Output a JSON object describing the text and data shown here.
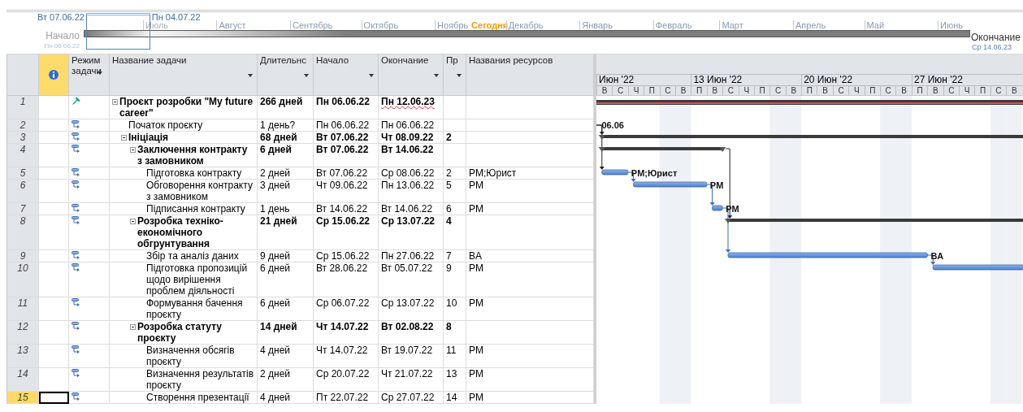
{
  "timeline": {
    "range_start": "Вт 07.06.22",
    "range_end": "Пн 04.07.22",
    "start_label": "Начало",
    "start_date": "Пн 06.06.22",
    "end_label": "Окончание",
    "end_date": "Ср 14.06.23",
    "months": [
      {
        "label": "Июль",
        "dimmed": true
      },
      {
        "label": "Август",
        "dimmed": false
      },
      {
        "label": "Сентябрь",
        "dimmed": false
      },
      {
        "label": "Октябрь",
        "dimmed": false
      },
      {
        "label": "Ноябрь",
        "dimmed": false,
        "today": "Сегодня"
      },
      {
        "label": "Декабрь",
        "dimmed": false
      },
      {
        "label": "Январь",
        "dimmed": false
      },
      {
        "label": "Февраль",
        "dimmed": false
      },
      {
        "label": "Март",
        "dimmed": false
      },
      {
        "label": "Апрель",
        "dimmed": false
      },
      {
        "label": "Май",
        "dimmed": false
      },
      {
        "label": "Июнь",
        "dimmed": false
      }
    ]
  },
  "table": {
    "columns": [
      {
        "label": "Режим задачи",
        "filter": true
      },
      {
        "label": "Название задачи",
        "filter": true
      },
      {
        "label": "Длительнс",
        "filter": true
      },
      {
        "label": "Начало",
        "filter": true
      },
      {
        "label": "Окончание",
        "filter": true
      },
      {
        "label": "Пр",
        "filter": true
      },
      {
        "label": "Названия ресурсов",
        "filter": false
      }
    ],
    "rows": [
      {
        "id": "1",
        "manual": true,
        "kind": "project",
        "name": "Проєкт розробки \"My future career\"",
        "duration": "266 дней",
        "start": "Пн 06.06.22",
        "finish": "Пн 12.06.23",
        "finish_flagged": true,
        "expanded": true,
        "selected": false,
        "children": [
          {
            "id": "2",
            "manual": false,
            "kind": "milestone",
            "name": "Початок проєкту",
            "duration": "1 день?",
            "start": "Пн 06.06.22",
            "finish": "Пн 06.06.22",
            "selected": false,
            "bar_label": "06.06"
          },
          {
            "id": "3",
            "manual": false,
            "kind": "summary",
            "name": "Ініціація",
            "duration": "68 дней",
            "start": "Вт 07.06.22",
            "finish": "Чт 08.09.22",
            "predecessors": "2",
            "expanded": true,
            "selected": false,
            "children": [
              {
                "id": "4",
                "manual": false,
                "kind": "summary",
                "name": "Заключення контракту з замовником",
                "duration": "6 дней",
                "start": "Вт 07.06.22",
                "finish": "Вт 14.06.22",
                "expanded": true,
                "selected": false,
                "children": [
                  {
                    "id": "5",
                    "manual": false,
                    "kind": "task",
                    "name": "Підготовка контракту",
                    "duration": "2 дней",
                    "start": "Вт 07.06.22",
                    "finish": "Ср 08.06.22",
                    "predecessors": "2",
                    "resources": "PM;Юрист",
                    "selected": false,
                    "bar_label": "PM;Юрист"
                  },
                  {
                    "id": "6",
                    "manual": false,
                    "kind": "task",
                    "name": "Обговорення контракту з замовником",
                    "duration": "3 дней",
                    "start": "Чт 09.06.22",
                    "finish": "Пн 13.06.22",
                    "predecessors": "5",
                    "resources": "PM",
                    "selected": false,
                    "bar_label": "PM"
                  },
                  {
                    "id": "7",
                    "manual": false,
                    "kind": "task",
                    "name": "Підписання контракту",
                    "duration": "1 день",
                    "start": "Вт 14.06.22",
                    "finish": "Вт 14.06.22",
                    "predecessors": "6",
                    "resources": "PM",
                    "selected": false,
                    "bar_label": "PM"
                  }
                ]
              },
              {
                "id": "8",
                "manual": false,
                "kind": "summary",
                "name": "Розробка техніко-економічного обгрунтування",
                "duration": "21 дней",
                "start": "Ср 15.06.22",
                "finish": "Ср 13.07.22",
                "predecessors": "4",
                "expanded": true,
                "selected": false,
                "children": [
                  {
                    "id": "9",
                    "manual": false,
                    "kind": "task",
                    "name": "Збір та аналіз даних",
                    "duration": "9 дней",
                    "start": "Ср 15.06.22",
                    "finish": "Пн 27.06.22",
                    "predecessors": "7",
                    "resources": "BA",
                    "selected": false,
                    "bar_label": "BA"
                  },
                  {
                    "id": "10",
                    "manual": false,
                    "kind": "task",
                    "name": "Підготовка пропозицій щодо вирішення проблем діяльності",
                    "duration": "6 дней",
                    "start": "Вт 28.06.22",
                    "finish": "Вт 05.07.22",
                    "predecessors": "9",
                    "resources": "PM",
                    "selected": false
                  },
                  {
                    "id": "11",
                    "manual": false,
                    "kind": "task",
                    "name": "Формування бачення проєкту",
                    "duration": "6 дней",
                    "start": "Ср 06.07.22",
                    "finish": "Ср 13.07.22",
                    "predecessors": "10",
                    "resources": "PM",
                    "selected": false
                  }
                ]
              },
              {
                "id": "12",
                "manual": false,
                "kind": "summary",
                "name": "Розробка статуту проєкту",
                "duration": "14 дней",
                "start": "Чт 14.07.22",
                "finish": "Вт 02.08.22",
                "predecessors": "8",
                "expanded": true,
                "selected": false,
                "children": [
                  {
                    "id": "13",
                    "manual": false,
                    "kind": "task",
                    "name": "Визначення обсягів проєкту",
                    "duration": "4 дней",
                    "start": "Чт 14.07.22",
                    "finish": "Вт 19.07.22",
                    "predecessors": "11",
                    "resources": "PM",
                    "selected": false
                  },
                  {
                    "id": "14",
                    "manual": false,
                    "kind": "task",
                    "name": "Визначення результатів проєкту",
                    "duration": "2 дней",
                    "start": "Ср 20.07.22",
                    "finish": "Чт 21.07.22",
                    "predecessors": "13",
                    "resources": "PM",
                    "selected": false
                  },
                  {
                    "id": "15",
                    "manual": false,
                    "kind": "task",
                    "name": "Створення презентації",
                    "duration": "4 дней",
                    "start": "Пт 22.07.22",
                    "finish": "Ср 27.07.22",
                    "predecessors": "14",
                    "resources": "PM",
                    "selected": true
                  }
                ]
              }
            ]
          }
        ]
      }
    ]
  },
  "gantt": {
    "weeks": [
      {
        "label": "Июн '22",
        "days": [
          "В",
          "С",
          "Ч",
          "П",
          "С",
          "В"
        ]
      },
      {
        "label": "13 Июн '22",
        "days": [
          "П",
          "В",
          "С",
          "Ч",
          "П",
          "С",
          "В"
        ]
      },
      {
        "label": "20 Июн '22",
        "days": [
          "П",
          "В",
          "С",
          "Ч",
          "П",
          "С",
          "В"
        ]
      },
      {
        "label": "27 Июн '22",
        "days": [
          "П",
          "В",
          "С",
          "Ч",
          "П",
          "С",
          "В"
        ]
      }
    ]
  }
}
